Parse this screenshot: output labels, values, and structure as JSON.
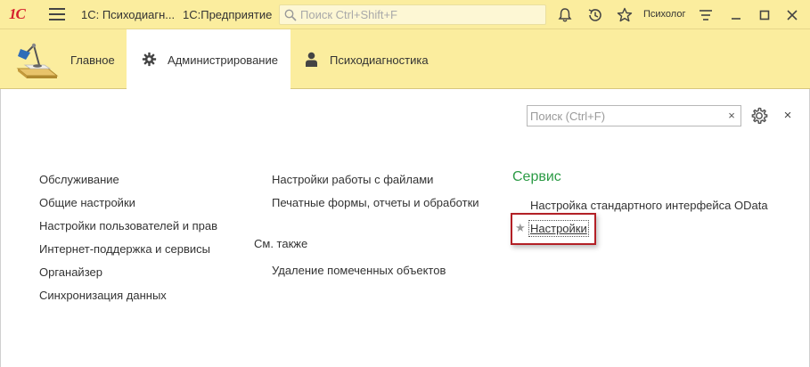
{
  "titlebar": {
    "logo": "1С",
    "app_title": "1С: Психодиагн...",
    "platform": "1С:Предприятие",
    "search_placeholder": "Поиск Ctrl+Shift+F",
    "user": "Психолог"
  },
  "sections": [
    {
      "label": "Главное"
    },
    {
      "label": "Администрирование"
    },
    {
      "label": "Психодиагностика"
    }
  ],
  "content": {
    "search_placeholder": "Поиск (Ctrl+F)",
    "clear_label": "×",
    "close_label": "×",
    "col1": [
      "Обслуживание",
      "Общие настройки",
      "Настройки пользователей и прав",
      "Интернет-поддержка и сервисы",
      "Органайзер",
      "Синхронизация данных"
    ],
    "col2": [
      "Настройки работы с файлами",
      "Печатные формы, отчеты и обработки"
    ],
    "see_also_title": "См. также",
    "see_also_items": [
      "Удаление помеченных объектов"
    ],
    "service_title": "Сервис",
    "service_items": [
      "Настройка стандартного интерфейса OData",
      "Настройки"
    ],
    "star": "★"
  },
  "colors": {
    "panel_bg": "#fbed9e",
    "group_title": "#2c9b46",
    "highlight": "#b32026",
    "logo": "#d5212e"
  }
}
